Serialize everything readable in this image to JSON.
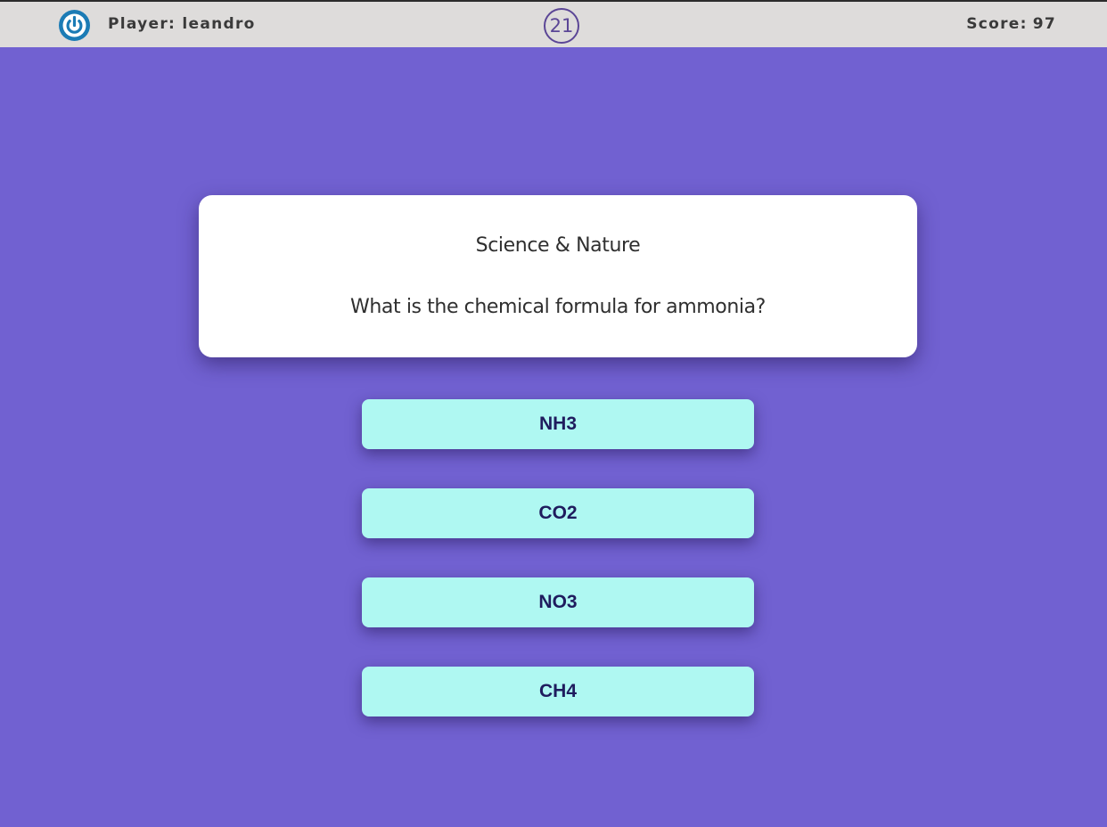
{
  "header": {
    "logout_icon": "power-icon",
    "player_label": "Player:",
    "player_name": "leandro",
    "timer": "21",
    "score_label": "Score:",
    "score_value": "97"
  },
  "colors": {
    "background": "#7161d1",
    "header_bg": "#dedcdb",
    "answer_bg": "#aff8f2",
    "answer_text": "#1f1c5e",
    "timer_accent": "#5b4696",
    "power_icon": "#1b7bb5"
  },
  "question": {
    "category": "Science & Nature",
    "text": "What is the chemical formula for ammonia?"
  },
  "answers": [
    {
      "label": "NH3"
    },
    {
      "label": "CO2"
    },
    {
      "label": "NO3"
    },
    {
      "label": "CH4"
    }
  ]
}
